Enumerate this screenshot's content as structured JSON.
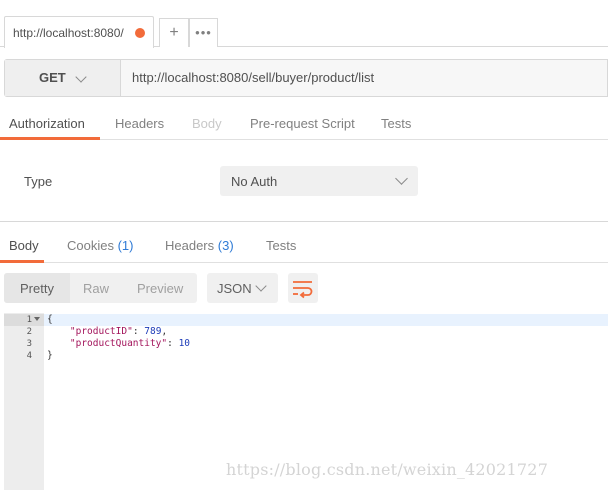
{
  "request_tab": {
    "label": "http://localhost:8080/",
    "add_glyph": "+",
    "more_glyph": "•••"
  },
  "request": {
    "method": "GET",
    "url": "http://localhost:8080/sell/buyer/product/list"
  },
  "request_tabs": [
    {
      "label": "Authorization",
      "state": "active"
    },
    {
      "label": "Headers",
      "state": "normal"
    },
    {
      "label": "Body",
      "state": "disabled"
    },
    {
      "label": "Pre-request Script",
      "state": "normal"
    },
    {
      "label": "Tests",
      "state": "normal"
    }
  ],
  "auth": {
    "type_label": "Type",
    "type_value": "No Auth"
  },
  "response_tabs": {
    "body": "Body",
    "cookies": "Cookies",
    "cookies_count": "(1)",
    "headers": "Headers",
    "headers_count": "(3)",
    "tests": "Tests"
  },
  "view_modes": {
    "pretty": "Pretty",
    "raw": "Raw",
    "preview": "Preview"
  },
  "format": "JSON",
  "code": {
    "line_numbers": [
      "1",
      "2",
      "3",
      "4"
    ],
    "open_brace": "{",
    "close_brace": "}",
    "fields": [
      {
        "key": "\"productID\"",
        "sep": ": ",
        "value": "789",
        "trail": ","
      },
      {
        "key": "\"productQuantity\"",
        "sep": ": ",
        "value": "10",
        "trail": ""
      }
    ]
  },
  "watermark": "https://blog.csdn.net/weixin_42021727",
  "colors": {
    "accent": "#f26b3a",
    "count_blue": "#2f7bd6",
    "json_key": "#a3155c",
    "json_number": "#1c3bb8"
  }
}
